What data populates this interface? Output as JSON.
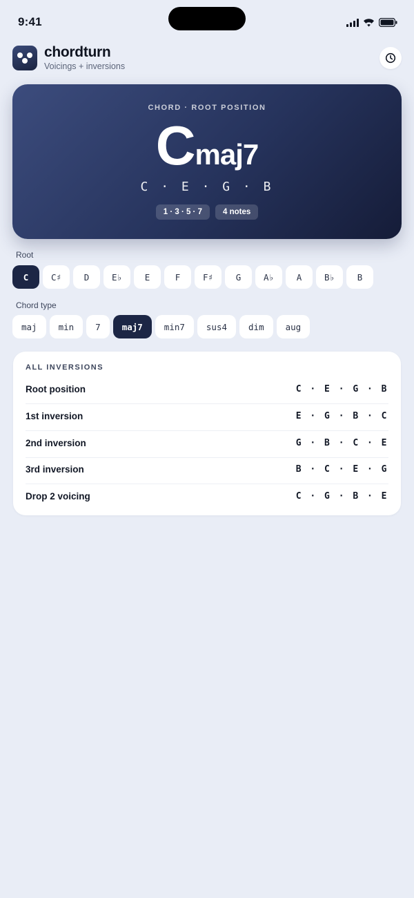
{
  "status_bar": {
    "time": "9:41"
  },
  "header": {
    "title": "chordturn",
    "subtitle": "Voicings + inversions",
    "history_icon": "clock-icon"
  },
  "hero": {
    "eyebrow": "CHORD · ROOT POSITION",
    "root": "C",
    "quality": "maj7",
    "notes": "C · E · G · B",
    "badges": [
      "1 · 3 · 5 · 7",
      "4 notes"
    ]
  },
  "root_section": {
    "label": "Root",
    "selected": "C",
    "options": [
      "C",
      "C♯",
      "D",
      "E♭",
      "E",
      "F",
      "F♯",
      "G",
      "A♭",
      "A",
      "B♭",
      "B"
    ]
  },
  "type_section": {
    "label": "Chord type",
    "selected": "maj7",
    "options": [
      "maj",
      "min",
      "7",
      "maj7",
      "min7",
      "sus4",
      "dim",
      "aug"
    ]
  },
  "inversions": {
    "heading": "ALL INVERSIONS",
    "rows": [
      {
        "name": "Root position",
        "notes": "C · E · G · B"
      },
      {
        "name": "1st inversion",
        "notes": "E · G · B · C"
      },
      {
        "name": "2nd inversion",
        "notes": "G · B · C · E"
      },
      {
        "name": "3rd inversion",
        "notes": "B · C · E · G"
      },
      {
        "name": "Drop 2 voicing",
        "notes": "C · G · B · E"
      }
    ]
  },
  "colors": {
    "background": "#e9edf6",
    "accent": "#1c2645",
    "card": "#ffffff"
  }
}
